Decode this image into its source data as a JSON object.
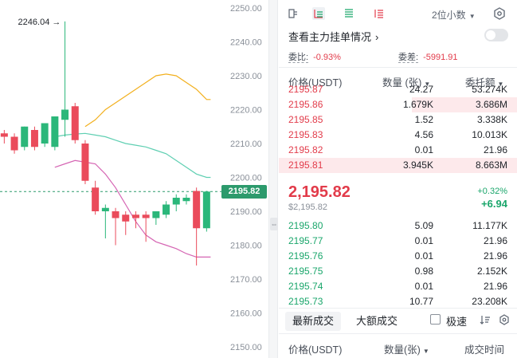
{
  "chart": {
    "price_ticks": [
      "2250.00",
      "2240.00",
      "2230.00",
      "2220.00",
      "2210.00",
      "2200.00",
      "2190.00",
      "2180.00",
      "2170.00",
      "2160.00",
      "2150.00"
    ],
    "high_label": "2246.04 →",
    "current_price_tag": "2195.82",
    "colors": {
      "up": "#2bb77a",
      "down": "#ea4b5b",
      "ma_orange": "#f2b01e",
      "ma_teal": "#5fcfb2",
      "ma_pink": "#d565b3",
      "tag_bg": "#2c9a6c"
    }
  },
  "chart_data": {
    "type": "candlestick",
    "ylim": [
      2150,
      2252
    ],
    "candles": [
      {
        "o": 2213,
        "h": 2214,
        "l": 2210,
        "c": 2212
      },
      {
        "o": 2212,
        "h": 2213,
        "l": 2207,
        "c": 2208
      },
      {
        "o": 2209,
        "h": 2215,
        "l": 2208,
        "c": 2215
      },
      {
        "o": 2214,
        "h": 2215,
        "l": 2208,
        "c": 2209
      },
      {
        "o": 2210,
        "h": 2216,
        "l": 2209,
        "c": 2216
      },
      {
        "o": 2209,
        "h": 2218,
        "l": 2208,
        "c": 2218
      },
      {
        "o": 2217,
        "h": 2246.04,
        "l": 2212,
        "c": 2220
      },
      {
        "o": 2221,
        "h": 2222,
        "l": 2210,
        "c": 2211
      },
      {
        "o": 2210,
        "h": 2211,
        "l": 2198,
        "c": 2199
      },
      {
        "o": 2197,
        "h": 2199,
        "l": 2189,
        "c": 2190
      },
      {
        "o": 2190,
        "h": 2192,
        "l": 2182,
        "c": 2191
      },
      {
        "o": 2190,
        "h": 2191,
        "l": 2180,
        "c": 2188
      },
      {
        "o": 2189,
        "h": 2190,
        "l": 2183,
        "c": 2187
      },
      {
        "o": 2189,
        "h": 2190,
        "l": 2185,
        "c": 2188
      },
      {
        "o": 2189,
        "h": 2190,
        "l": 2181,
        "c": 2188
      },
      {
        "o": 2188,
        "h": 2190,
        "l": 2186,
        "c": 2190
      },
      {
        "o": 2189,
        "h": 2193,
        "l": 2188,
        "c": 2192
      },
      {
        "o": 2192,
        "h": 2195,
        "l": 2190,
        "c": 2194
      },
      {
        "o": 2193,
        "h": 2195,
        "l": 2192,
        "c": 2194
      },
      {
        "o": 2196,
        "h": 2197,
        "l": 2174,
        "c": 2185
      },
      {
        "o": 2185,
        "h": 2196,
        "l": 2184,
        "c": 2195.82
      }
    ],
    "ma_series": [
      {
        "color": "#f2b01e",
        "values": [
          null,
          null,
          null,
          null,
          null,
          null,
          null,
          null,
          2215,
          2217,
          2220,
          2222,
          2224,
          2226,
          2228,
          2230,
          2230.5,
          2230,
          2228,
          2226,
          2223
        ]
      },
      {
        "color": "#5fcfb2",
        "values": [
          null,
          null,
          null,
          null,
          null,
          2212,
          2212.5,
          2212.8,
          2213,
          2212.5,
          2212,
          2211,
          2210,
          2209.5,
          2209,
          2208,
          2207,
          2205,
          2203,
          2201,
          2200
        ]
      },
      {
        "color": "#d565b3",
        "values": [
          null,
          null,
          null,
          null,
          null,
          2203,
          2204,
          2205,
          2204.5,
          2204,
          2201,
          2197,
          2192,
          2187,
          2183,
          2181,
          2180,
          2179,
          2177.5,
          2176.5,
          2176.5
        ]
      }
    ]
  },
  "book": {
    "decimals": "2位小数",
    "main_force_link": "查看主力挂单情况",
    "ratio_label": "委比:",
    "ratio_value": "-0.93%",
    "diff_label": "委差:",
    "diff_value": "-5991.91",
    "col_price": "价格(USDT)",
    "col_amount": "数量 (张)",
    "col_total": "委托额",
    "asks": [
      {
        "price": "2195.87",
        "amount": "24.27",
        "total": "53.274K",
        "depth": 0
      },
      {
        "price": "2195.86",
        "amount": "1.679K",
        "total": "3.686M",
        "depth": 0.44
      },
      {
        "price": "2195.85",
        "amount": "1.52",
        "total": "3.338K",
        "depth": 0
      },
      {
        "price": "2195.83",
        "amount": "4.56",
        "total": "10.013K",
        "depth": 0
      },
      {
        "price": "2195.82",
        "amount": "0.01",
        "total": "21.96",
        "depth": 0
      },
      {
        "price": "2195.81",
        "amount": "3.945K",
        "total": "8.663M",
        "depth": 1
      }
    ],
    "last_price": "2,195.82",
    "last_usd": "$2,195.82",
    "change_pct": "+0.32%",
    "change_abs": "+6.94",
    "bids": [
      {
        "price": "2195.80",
        "amount": "5.09",
        "total": "11.177K",
        "depth": 0
      },
      {
        "price": "2195.77",
        "amount": "0.01",
        "total": "21.96",
        "depth": 0
      },
      {
        "price": "2195.76",
        "amount": "0.01",
        "total": "21.96",
        "depth": 0
      },
      {
        "price": "2195.75",
        "amount": "0.98",
        "total": "2.152K",
        "depth": 0
      },
      {
        "price": "2195.74",
        "amount": "0.01",
        "total": "21.96",
        "depth": 0
      },
      {
        "price": "2195.73",
        "amount": "10.77",
        "total": "23.208K",
        "depth": 0
      }
    ],
    "tab_latest": "最新成交",
    "tab_large": "大额成交",
    "fast_label": "极速",
    "trade_col_price": "价格(USDT)",
    "trade_col_amount": "数量(张)",
    "trade_col_time": "成交时间"
  }
}
